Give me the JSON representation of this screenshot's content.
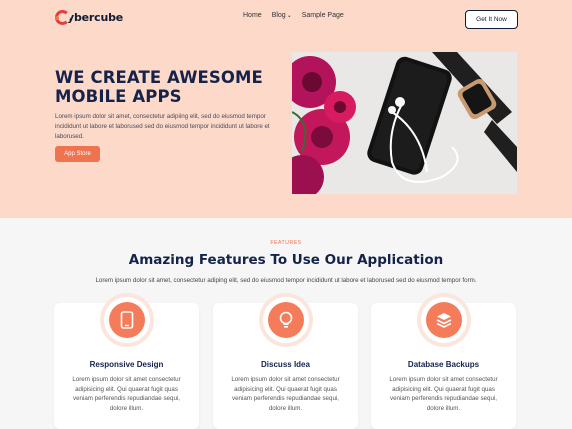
{
  "brand": {
    "name": "ybercube"
  },
  "nav": {
    "items": [
      "Home",
      "Blog",
      "Sample Page"
    ],
    "cta": "Get It Now"
  },
  "hero": {
    "title_line1": "WE CREATE AWESOME",
    "title_line2": "MOBILE APPS",
    "text": "Lorem ipsum dolor sit amet, consectetur adipiing elit, sed do eiusmod tempor incididunt ut labore et laborused sed do eiusmod tempor incididunt ut labore et laborused.",
    "button": "App Store"
  },
  "features": {
    "tag": "FEATURES",
    "title": "Amazing Features To Use Our Application",
    "subtitle": "Lorem ipsum dolor sit amet, consectetur adiping elit, sed do eiusmod tempor incididunt ut labore et laborused sed do eiusmod tempor form.",
    "cards": [
      {
        "icon": "mobile-icon",
        "title": "Responsive Design",
        "text": "Lorem ipsum dolor sit amet consectetur adipisicing elit. Qui quaerat fugit quas veniam perferendis repudiandae sequi, dolore illum."
      },
      {
        "icon": "lightbulb-icon",
        "title": "Discuss Idea",
        "text": "Lorem ipsum dolor sit amet consectetur adipisicing elit. Qui quaerat fugit quas veniam perferendis repudiandae sequi, dolore illum."
      },
      {
        "icon": "layers-icon",
        "title": "Database Backups",
        "text": "Lorem ipsum dolor sit amet consectetur adipisicing elit. Qui quaerat fugit quas veniam perferendis repudiandae sequi, dolore illum."
      }
    ]
  },
  "colors": {
    "accent": "#f0734f",
    "hero_bg": "#fdd9c9",
    "navy": "#15234b"
  }
}
